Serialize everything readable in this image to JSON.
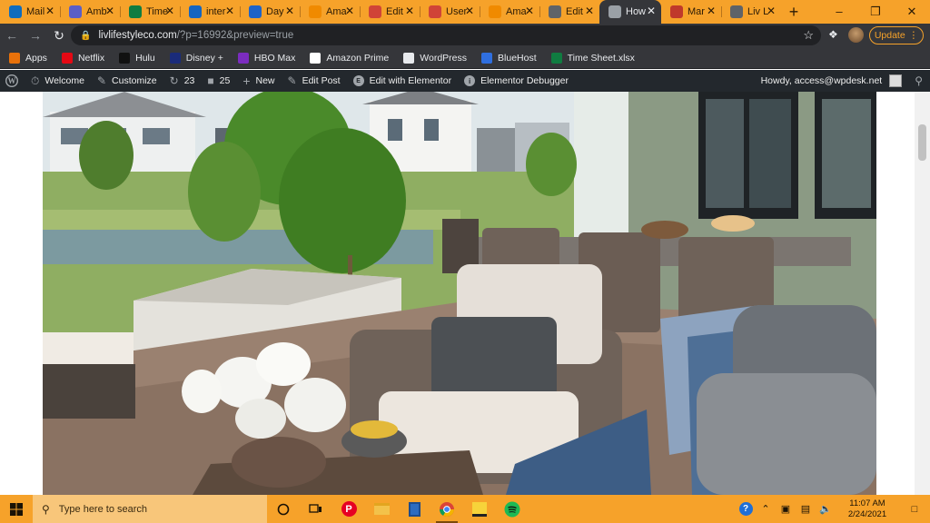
{
  "tabs": [
    {
      "label": "Mail",
      "icon": "outlook-icon",
      "color": "#0f6cbd"
    },
    {
      "label": "Amb",
      "icon": "teams-icon",
      "color": "#5b5fc7"
    },
    {
      "label": "Time",
      "icon": "excel-icon",
      "color": "#107c41"
    },
    {
      "label": "inter",
      "icon": "stick-figure-icon",
      "color": "#1565c0"
    },
    {
      "label": "Day",
      "icon": "circle-arc-icon",
      "color": "#1e63c7"
    },
    {
      "label": "Ama",
      "icon": "amazon-icon",
      "color": "#f08a00"
    },
    {
      "label": "Edit",
      "icon": "broken-link-icon",
      "color": "#d04437"
    },
    {
      "label": "User",
      "icon": "broken-link-icon",
      "color": "#d04437"
    },
    {
      "label": "Ama",
      "icon": "amazon-icon",
      "color": "#f08a00"
    },
    {
      "label": "Edit",
      "icon": "globe-icon",
      "color": "#5f6368"
    },
    {
      "label": "How",
      "icon": "globe-icon",
      "color": "#9aa0a6",
      "active": true
    },
    {
      "label": "Mar",
      "icon": "red-logo-icon",
      "color": "#c0392b"
    },
    {
      "label": "Liv L",
      "icon": "globe-icon",
      "color": "#5f6368"
    }
  ],
  "address": {
    "host": "livlifestyleco.com",
    "path": "/?p=16992&preview=true"
  },
  "update_label": "Update",
  "bookmarks": [
    {
      "label": "Apps",
      "icon": "apps-grid-icon",
      "color": "#e8710a"
    },
    {
      "label": "Netflix",
      "icon": "netflix-icon",
      "color": "#e50914"
    },
    {
      "label": "Hulu",
      "icon": "hulu-icon",
      "color": "#111111"
    },
    {
      "label": "Disney +",
      "icon": "disney-icon",
      "color": "#1a2b7a"
    },
    {
      "label": "HBO Max",
      "icon": "hbo-max-icon",
      "color": "#7b2cbf"
    },
    {
      "label": "Amazon Prime",
      "icon": "amazon-icon",
      "color": "#ffffff"
    },
    {
      "label": "WordPress",
      "icon": "globe-icon",
      "color": "#e8eaed"
    },
    {
      "label": "BlueHost",
      "icon": "bluehost-icon",
      "color": "#2f6fdf"
    },
    {
      "label": "Time Sheet.xlsx",
      "icon": "excel-icon",
      "color": "#107c41"
    }
  ],
  "wpbar": {
    "welcome": "Welcome",
    "customize": "Customize",
    "updates": "23",
    "comments": "25",
    "new": "New",
    "edit_post": "Edit Post",
    "edit_elementor": "Edit with Elementor",
    "debugger": "Elementor Debugger",
    "howdy": "Howdy, access@wpdesk.net"
  },
  "taskbar": {
    "search_placeholder": "Type here to search",
    "time": "11:07 AM",
    "date": "2/24/2021"
  }
}
